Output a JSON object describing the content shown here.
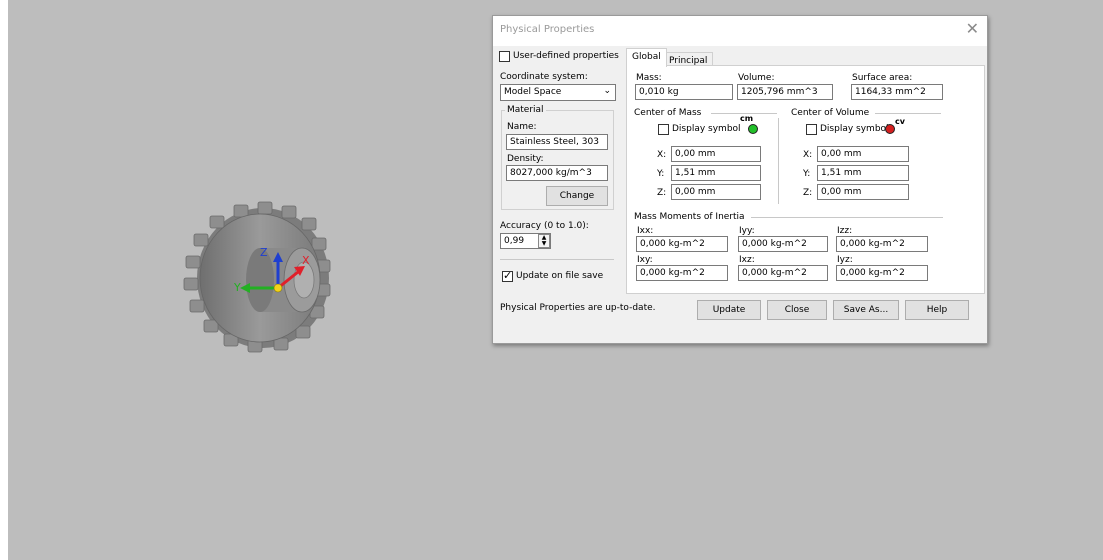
{
  "dialog": {
    "title": "Physical Properties",
    "close_glyph": "✕",
    "user_defined_label": "User-defined properties",
    "coordinate_system_label": "Coordinate system:",
    "coordinate_system_value": "Model Space",
    "material": {
      "group_label": "Material",
      "name_label": "Name:",
      "name_value": "Stainless Steel, 303",
      "density_label": "Density:",
      "density_value": "8027,000 kg/m^3",
      "change_button": "Change"
    },
    "accuracy_label": "Accuracy (0 to 1.0):",
    "accuracy_value": "0,99",
    "update_on_save_label": "Update on file save",
    "update_on_save_checked": true,
    "status_text": "Physical Properties are up-to-date.",
    "tabs": [
      {
        "label": "Global"
      },
      {
        "label": "Principal"
      }
    ],
    "global": {
      "mass_label": "Mass:",
      "mass_value": "0,010 kg",
      "volume_label": "Volume:",
      "volume_value": "1205,796 mm^3",
      "surface_label": "Surface area:",
      "surface_value": "1164,33 mm^2",
      "com": {
        "group_label": "Center of Mass",
        "display_label": "Display symbol",
        "symbol_text": "cm",
        "symbol_color": "#22c02a",
        "x_label": "X:",
        "x_value": "0,00 mm",
        "y_label": "Y:",
        "y_value": "1,51 mm",
        "z_label": "Z:",
        "z_value": "0,00 mm"
      },
      "cov": {
        "group_label": "Center of Volume",
        "display_label": "Display symbol",
        "symbol_text": "cv",
        "symbol_color": "#d41f1f",
        "x_label": "X:",
        "x_value": "0,00 mm",
        "y_label": "Y:",
        "y_value": "1,51 mm",
        "z_label": "Z:",
        "z_value": "0,00 mm"
      },
      "inertia": {
        "group_label": "Mass Moments of Inertia",
        "ixx_label": "Ixx:",
        "ixx_value": "0,000 kg-m^2",
        "iyy_label": "Iyy:",
        "iyy_value": "0,000 kg-m^2",
        "izz_label": "Izz:",
        "izz_value": "0,000 kg-m^2",
        "ixy_label": "Ixy:",
        "ixy_value": "0,000 kg-m^2",
        "ixz_label": "Ixz:",
        "ixz_value": "0,000 kg-m^2",
        "iyz_label": "Iyz:",
        "iyz_value": "0,000 kg-m^2"
      }
    },
    "buttons": {
      "update": "Update",
      "close": "Close",
      "save_as": "Save As...",
      "help": "Help"
    }
  },
  "triad": {
    "x_label": "X",
    "y_label": "Y",
    "z_label": "Z",
    "x_color": "#e0202a",
    "y_color": "#22b022",
    "z_color": "#1f3fd0"
  },
  "colors": {
    "viewport_bg": "#bdbdbd",
    "gear": "#8c8c8c",
    "dialog_bg": "#f0f0f0"
  }
}
